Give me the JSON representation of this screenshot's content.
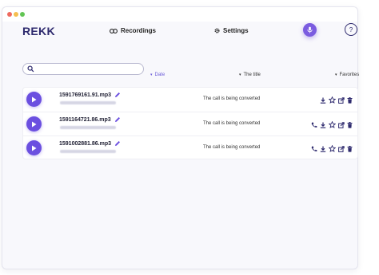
{
  "app": {
    "logo": "REKK"
  },
  "nav": {
    "recordings_label": "Recordings",
    "settings_label": "Settings",
    "help_label": "?"
  },
  "colors": {
    "accent": "#6b4fe0",
    "brand_text": "#2e2a6e"
  },
  "search": {
    "value": "",
    "placeholder": ""
  },
  "sort": {
    "date_label": "Date",
    "title_label": "The title",
    "favorites_label": "Favorites"
  },
  "recordings": [
    {
      "filename": "1591769161.91.mp3",
      "status": "The call is being converted",
      "actions": [
        "download-icon",
        "star-icon",
        "share-icon",
        "trash-icon"
      ]
    },
    {
      "filename": "1591164721.86.mp3",
      "status": "The call is being converted",
      "actions": [
        "phone-icon",
        "download-icon",
        "star-icon",
        "share-icon",
        "trash-icon"
      ]
    },
    {
      "filename": "1591002881.86.mp3",
      "status": "The call is being converted",
      "actions": [
        "phone-icon",
        "download-icon",
        "star-icon",
        "share-icon",
        "trash-icon"
      ]
    }
  ]
}
